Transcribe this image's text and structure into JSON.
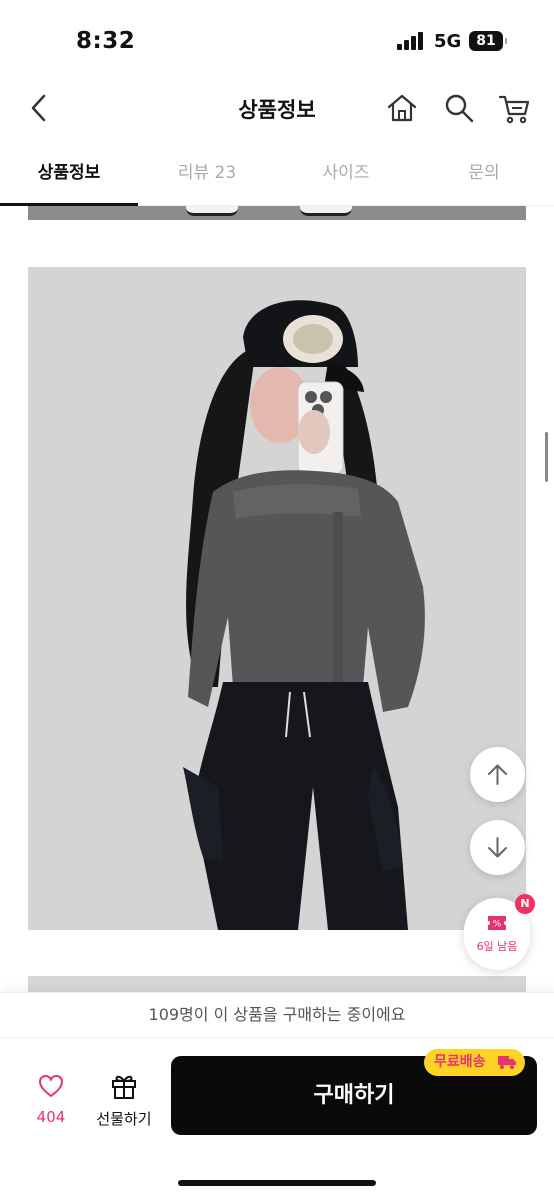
{
  "status_bar": {
    "time": "8:32",
    "network": "5G",
    "battery": "81"
  },
  "header": {
    "title": "상품정보",
    "icons": [
      "back-arrow-icon",
      "home-icon",
      "search-icon",
      "cart-icon"
    ]
  },
  "tabs": [
    {
      "label": "상품정보",
      "active": true
    },
    {
      "label": "리뷰 23",
      "active": false
    },
    {
      "label": "사이즈",
      "active": false
    },
    {
      "label": "문의",
      "active": false
    }
  ],
  "coupon": {
    "badge": "N",
    "label": "6일 남음"
  },
  "purchase_notice": "109명이 이 상품을 구매하는 중이에요",
  "bottom_bar": {
    "like_count": "404",
    "gift_label": "선물하기",
    "buy_label": "구매하기",
    "shipping_badge": "무료배송"
  },
  "colors": {
    "accent": "#e8336c",
    "buy_button": "#0a0a0a",
    "shipping_badge_bg": "#ffd226"
  }
}
